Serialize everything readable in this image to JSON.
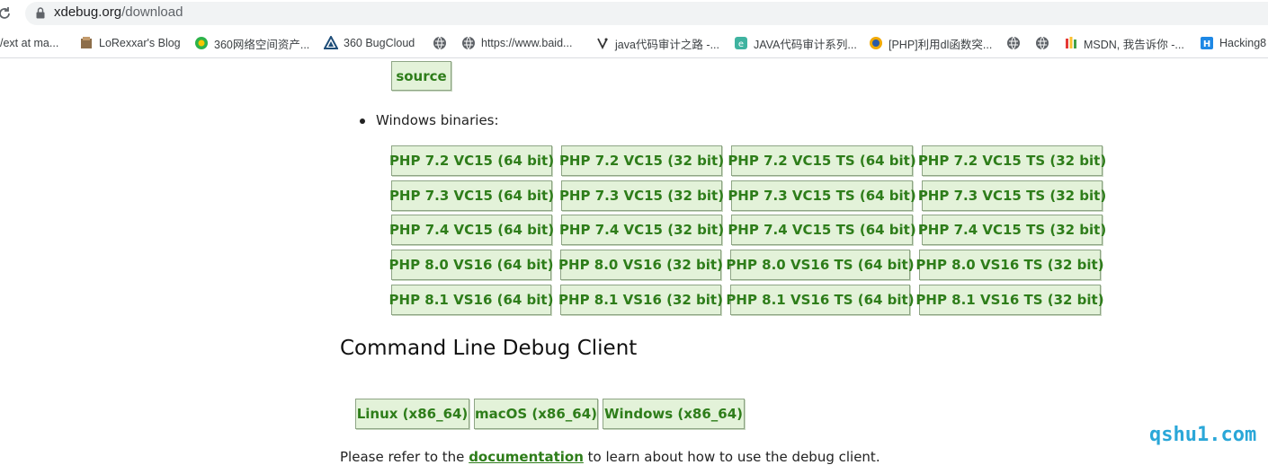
{
  "browser": {
    "url_host": "xdebug.org",
    "url_path": "/download",
    "bookmarks": [
      {
        "label": "/ext at ma...",
        "icon": "none"
      },
      {
        "label": "LoRexxar's Blog",
        "icon": "blog-icon"
      },
      {
        "label": "360网络空间资产...",
        "icon": "360-icon"
      },
      {
        "label": "360 BugCloud",
        "icon": "bugcloud-icon"
      },
      {
        "label": "",
        "icon": "globe-icon"
      },
      {
        "label": "https://www.baid...",
        "icon": "globe-icon"
      },
      {
        "label": "java代码审计之路 -...",
        "icon": "java-icon"
      },
      {
        "label": "JAVA代码审计系列...",
        "icon": "e-icon"
      },
      {
        "label": "[PHP]利用dl函数突...",
        "icon": "php-icon"
      },
      {
        "label": "",
        "icon": "globe-icon"
      },
      {
        "label": "",
        "icon": "globe-icon"
      },
      {
        "label": "MSDN, 我告诉你 -...",
        "icon": "msdn-icon"
      },
      {
        "label": "Hacking8",
        "icon": "h-icon"
      }
    ]
  },
  "page": {
    "source_label": "source",
    "windows_label": "Windows binaries:",
    "binaries": [
      [
        "PHP 7.2 VC15 (64 bit)",
        "PHP 7.2 VC15 (32 bit)",
        "PHP 7.2 VC15 TS (64 bit)",
        "PHP 7.2 VC15 TS (32 bit)"
      ],
      [
        "PHP 7.3 VC15 (64 bit)",
        "PHP 7.3 VC15 (32 bit)",
        "PHP 7.3 VC15 TS (64 bit)",
        "PHP 7.3 VC15 TS (32 bit)"
      ],
      [
        "PHP 7.4 VC15 (64 bit)",
        "PHP 7.4 VC15 (32 bit)",
        "PHP 7.4 VC15 TS (64 bit)",
        "PHP 7.4 VC15 TS (32 bit)"
      ],
      [
        "PHP 8.0 VS16 (64 bit)",
        "PHP 8.0 VS16 (32 bit)",
        "PHP 8.0 VS16 TS (64 bit)",
        "PHP 8.0 VS16 TS (32 bit)"
      ],
      [
        "PHP 8.1 VS16 (64 bit)",
        "PHP 8.1 VS16 (32 bit)",
        "PHP 8.1 VS16 TS (64 bit)",
        "PHP 8.1 VS16 TS (32 bit)"
      ]
    ],
    "cli_heading": "Command Line Debug Client",
    "cli_buttons": [
      "Linux (x86_64)",
      "macOS (x86_64)",
      "Windows (x86_64)"
    ],
    "refer_prefix": "Please refer to the",
    "refer_link": "documentation",
    "refer_suffix": "to learn about how to use the debug client."
  },
  "watermark": "qshu1.com",
  "colors": {
    "button_bg": "#e3f2d9",
    "button_text": "#2e7d1a",
    "watermark": "#2aa7d8"
  }
}
